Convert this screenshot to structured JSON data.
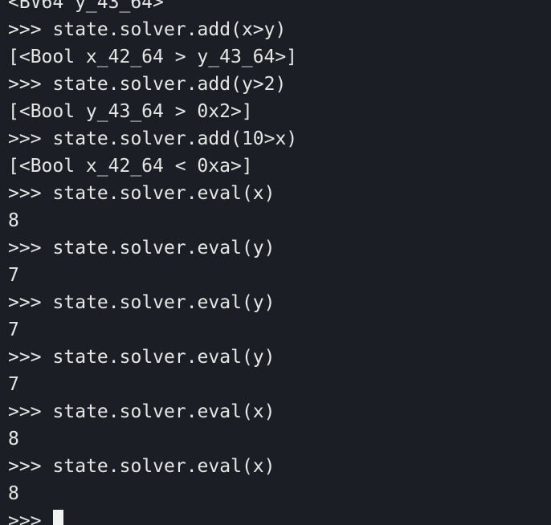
{
  "terminal": {
    "prompt": ">>>",
    "lines": [
      {
        "type": "output",
        "text": "<BV64 y_43_64>"
      },
      {
        "type": "input",
        "text": "state.solver.add(x>y)"
      },
      {
        "type": "output",
        "text": "[<Bool x_42_64 > y_43_64>]"
      },
      {
        "type": "input",
        "text": "state.solver.add(y>2)"
      },
      {
        "type": "output",
        "text": "[<Bool y_43_64 > 0x2>]"
      },
      {
        "type": "input",
        "text": "state.solver.add(10>x)"
      },
      {
        "type": "output",
        "text": "[<Bool x_42_64 < 0xa>]"
      },
      {
        "type": "input",
        "text": "state.solver.eval(x)"
      },
      {
        "type": "output",
        "text": "8"
      },
      {
        "type": "input",
        "text": "state.solver.eval(y)"
      },
      {
        "type": "output",
        "text": "7"
      },
      {
        "type": "input",
        "text": "state.solver.eval(y)"
      },
      {
        "type": "output",
        "text": "7"
      },
      {
        "type": "input",
        "text": "state.solver.eval(y)"
      },
      {
        "type": "output",
        "text": "7"
      },
      {
        "type": "input",
        "text": "state.solver.eval(x)"
      },
      {
        "type": "output",
        "text": "8"
      },
      {
        "type": "input",
        "text": "state.solver.eval(x)"
      },
      {
        "type": "output",
        "text": "8"
      }
    ]
  }
}
